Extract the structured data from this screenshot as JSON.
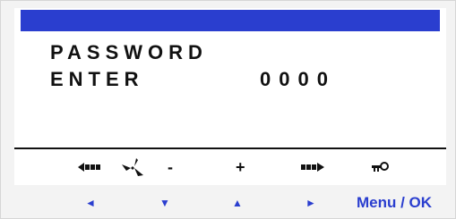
{
  "display": {
    "line1": "PASSWORD",
    "line2_label": "ENTER",
    "line2_value": "0000"
  },
  "function_keys": {
    "minus": "-",
    "plus": "+"
  },
  "nav_buttons": {
    "left": "◄",
    "down": "▼",
    "up": "▲",
    "right": "►",
    "menu_ok": "Menu / OK"
  },
  "colors": {
    "title_bar": "#2a3ecf",
    "nav_text": "#2a3ecf",
    "lcd_text": "#111111",
    "panel_bg": "#f3f3f3"
  },
  "icons": {
    "back_arrow": "scroll-back-icon",
    "fan": "fan-icon",
    "forward_arrow": "scroll-forward-icon",
    "key": "key-icon"
  }
}
